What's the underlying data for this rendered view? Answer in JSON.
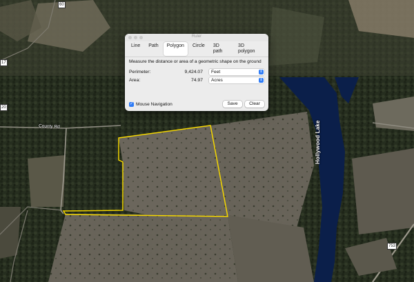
{
  "map": {
    "lake_label": "Hollywood Lake",
    "road_label": "County Rd",
    "route_shields": [
      "60",
      "17",
      "20",
      "753"
    ]
  },
  "ruler": {
    "title": "Ruler",
    "tabs": [
      "Line",
      "Path",
      "Polygon",
      "Circle",
      "3D path",
      "3D polygon"
    ],
    "active_tab": "Polygon",
    "description": "Measure the distance or area of a geometric shape on the ground",
    "perimeter": {
      "label": "Perimeter:",
      "value": "9,424.07",
      "unit": "Feet"
    },
    "area": {
      "label": "Area:",
      "value": "74.97",
      "unit": "Acres"
    },
    "mouse_navigation": {
      "label": "Mouse Navigation",
      "checked": true
    },
    "buttons": {
      "save": "Save",
      "clear": "Clear"
    }
  },
  "colors": {
    "polygon_outline": "#f5d700",
    "accent": "#2f7cf6",
    "lake": "#0b1f4a"
  }
}
